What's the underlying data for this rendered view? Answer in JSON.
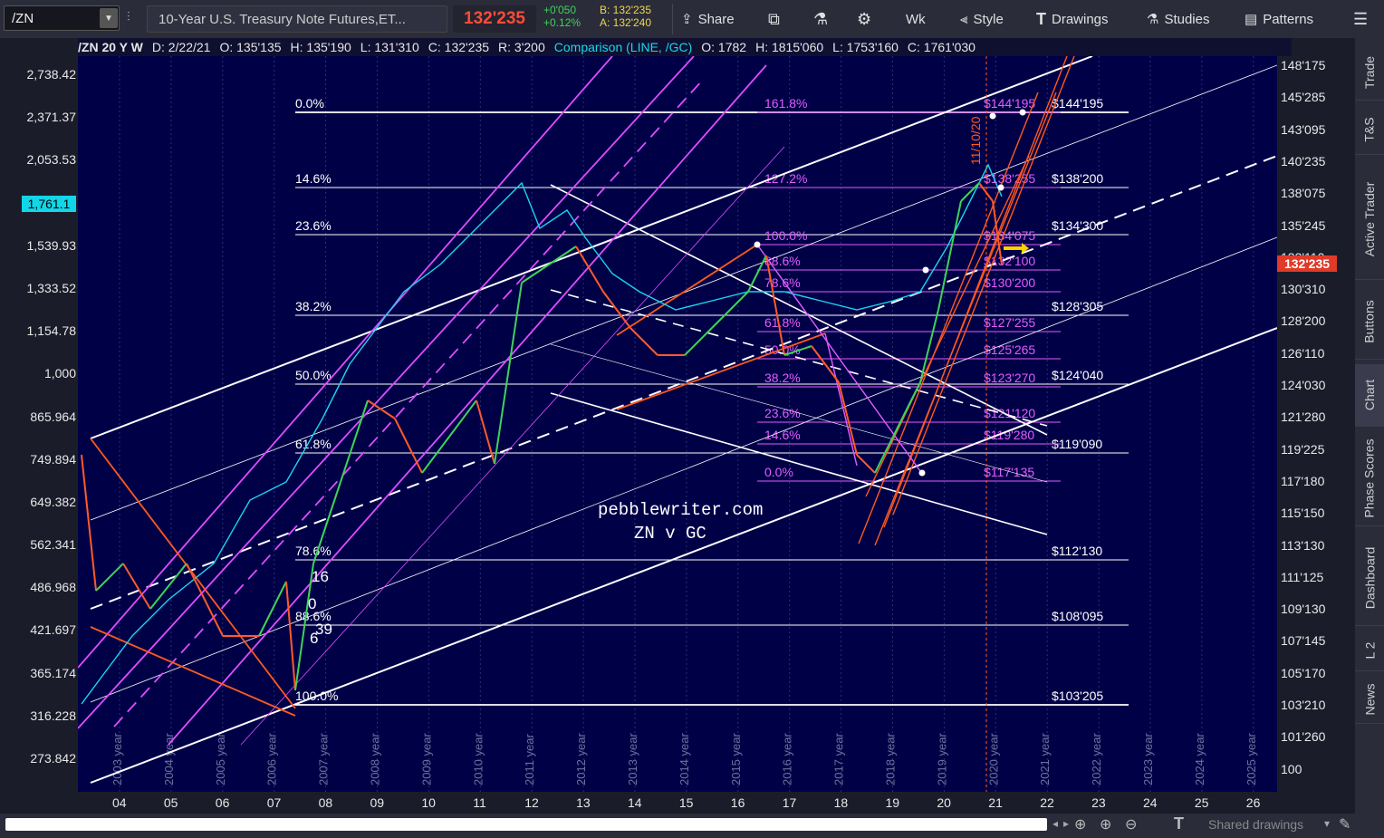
{
  "toolbar": {
    "symbol": "/ZN",
    "title": "10-Year U.S. Treasury Note Futures,ET...",
    "last": "132'235",
    "change": "+0'050",
    "change_pct": "+0.12%",
    "bid": "B: 132'235",
    "ask": "A: 132'240",
    "share": "Share",
    "aggregation": "Wk",
    "style": "Style",
    "drawings": "Drawings",
    "studies": "Studies",
    "patterns": "Patterns"
  },
  "infobar": {
    "series": "/ZN 20 Y W",
    "date": "D: 2/22/21",
    "open": "O: 135'135",
    "high": "H: 135'190",
    "low": "L: 131'310",
    "close": "C: 132'235",
    "range": "R: 3'200",
    "comparison": "Comparison (LINE, /GC)",
    "c_open": "O: 1782",
    "c_high": "H: 1815'060",
    "c_low": "L: 1753'160",
    "c_close": "C: 1761'030"
  },
  "left_axis": [
    "2,738.42",
    "2,371.37",
    "2,053.53",
    "1,539.93",
    "1,333.52",
    "1,154.78",
    "1,000",
    "865.964",
    "749.894",
    "649.382",
    "562.341",
    "486.968",
    "421.697",
    "365.174",
    "316.228",
    "273.842"
  ],
  "left_axis_current": "1,761.1",
  "right_axis": [
    "148'175",
    "145'285",
    "143'095",
    "140'235",
    "138'075",
    "135'245",
    "133'110",
    "130'310",
    "128'200",
    "126'110",
    "124'030",
    "121'280",
    "119'225",
    "117'180",
    "115'150",
    "113'130",
    "111'125",
    "109'130",
    "107'145",
    "105'170",
    "103'210",
    "101'260",
    "100"
  ],
  "right_axis_current": "132'235",
  "x_axis": [
    "04",
    "05",
    "06",
    "07",
    "08",
    "09",
    "10",
    "11",
    "12",
    "13",
    "14",
    "15",
    "16",
    "17",
    "18",
    "19",
    "20",
    "21",
    "22",
    "23",
    "24",
    "25",
    "26"
  ],
  "year_labels": [
    "2003 year",
    "2004 year",
    "2005 year",
    "2006 year",
    "2007 year",
    "2008 year",
    "2009 year",
    "2010 year",
    "2011 year",
    "2012 year",
    "2013 year",
    "2014 year",
    "2015 year",
    "2016 year",
    "2017 year",
    "2018 year",
    "2019 year",
    "2020 year",
    "2021 year",
    "2022 year",
    "2023 year",
    "2024 year",
    "2025 year"
  ],
  "fib_left": [
    "0.0%",
    "14.6%",
    "23.6%",
    "38.2%",
    "50.0%",
    "61.8%",
    "78.6%",
    "88.6%",
    "100.0%"
  ],
  "fib_left_values": [
    "$144'195",
    "$138'200",
    "$134'300",
    "$128'305",
    "$124'040",
    "$119'090",
    "$112'130",
    "$108'095",
    "$103'205"
  ],
  "fib_right": [
    "161.8%",
    "127.2%",
    "100.0%",
    "88.6%",
    "78.6%",
    "61.8%",
    "50.0%",
    "38.2%",
    "23.6%",
    "14.6%",
    "0.0%"
  ],
  "fib_right_values": [
    "$144'195",
    "$138'255",
    "$134'075",
    "$132'100",
    "$130'200",
    "$127'255",
    "$125'265",
    "$123'270",
    "$121'120",
    "$119'280",
    "$117'135"
  ],
  "watermark": [
    "pebblewriter.com",
    "ZN v GC"
  ],
  "annotation_date": "11/10/20",
  "count_labels": [
    "16",
    "0",
    "39",
    "6"
  ],
  "side_tabs": [
    "Trade",
    "T&S",
    "Active Trader",
    "Buttons",
    "Chart",
    "Phase Scores",
    "Dashboard",
    "L 2",
    "News"
  ],
  "bottom": {
    "shared": "Shared drawings"
  },
  "colors": {
    "candle_up": "#3fd25a",
    "candle_down": "#ff5a2a",
    "comparison": "#19d6ee",
    "fib_right": "#e25cff",
    "channel": "#e04cff",
    "wedge": "#ff5a1e",
    "background": "#000047",
    "last_price": "#e03a28"
  }
}
